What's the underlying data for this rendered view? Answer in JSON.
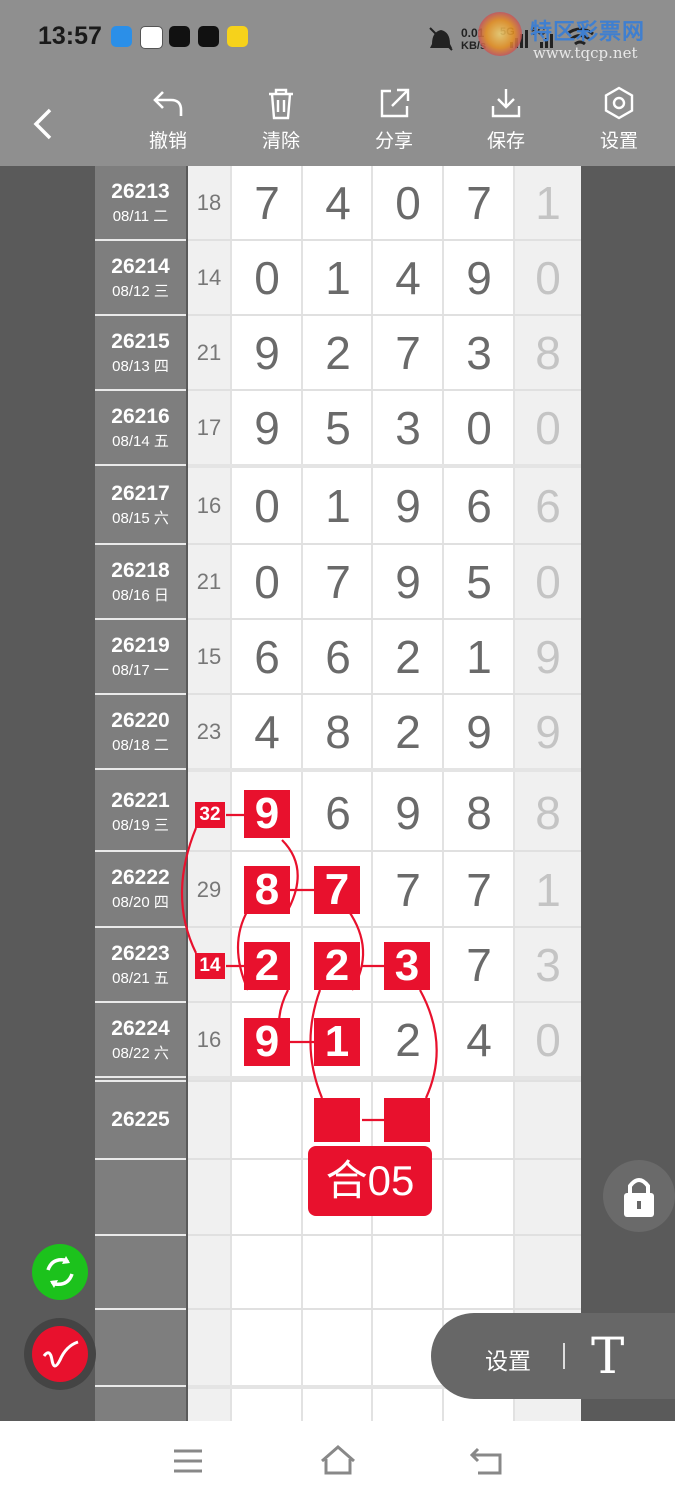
{
  "status": {
    "time": "13:57",
    "net_speed_top": "0.01",
    "net_speed_unit": "KB/s",
    "signal1": "5G",
    "signal2": "5G"
  },
  "watermark": {
    "site_name": "特区彩票网",
    "url": "www.tqcp.net"
  },
  "toolbar": {
    "undo": "撤销",
    "clear": "清除",
    "share": "分享",
    "save": "保存",
    "settings": "设置"
  },
  "rows": [
    {
      "period": "26213",
      "date": "08/11 二",
      "sum": "18",
      "digits": [
        "7",
        "4",
        "0",
        "7"
      ],
      "extra": "1"
    },
    {
      "period": "26214",
      "date": "08/12 三",
      "sum": "14",
      "digits": [
        "0",
        "1",
        "4",
        "9"
      ],
      "extra": "0"
    },
    {
      "period": "26215",
      "date": "08/13 四",
      "sum": "21",
      "digits": [
        "9",
        "2",
        "7",
        "3"
      ],
      "extra": "8"
    },
    {
      "period": "26216",
      "date": "08/14 五",
      "sum": "17",
      "digits": [
        "9",
        "5",
        "3",
        "0"
      ],
      "extra": "0"
    },
    {
      "period": "26217",
      "date": "08/15 六",
      "sum": "16",
      "digits": [
        "0",
        "1",
        "9",
        "6"
      ],
      "extra": "6"
    },
    {
      "period": "26218",
      "date": "08/16 日",
      "sum": "21",
      "digits": [
        "0",
        "7",
        "9",
        "5"
      ],
      "extra": "0"
    },
    {
      "period": "26219",
      "date": "08/17 一",
      "sum": "15",
      "digits": [
        "6",
        "6",
        "2",
        "1"
      ],
      "extra": "9"
    },
    {
      "period": "26220",
      "date": "08/18 二",
      "sum": "23",
      "digits": [
        "4",
        "8",
        "2",
        "9"
      ],
      "extra": "9"
    },
    {
      "period": "26221",
      "date": "08/19 三",
      "sum": "32",
      "digits": [
        "9",
        "6",
        "9",
        "8"
      ],
      "extra": "8"
    },
    {
      "period": "26222",
      "date": "08/20 四",
      "sum": "29",
      "digits": [
        "8",
        "7",
        "7",
        "7"
      ],
      "extra": "1"
    },
    {
      "period": "26223",
      "date": "08/21 五",
      "sum": "14",
      "digits": [
        "2",
        "2",
        "3",
        "7"
      ],
      "extra": "3"
    },
    {
      "period": "26224",
      "date": "08/22 六",
      "sum": "16",
      "digits": [
        "9",
        "1",
        "2",
        "4"
      ],
      "extra": "0"
    }
  ],
  "next_period": "26225",
  "prediction_label": "合05",
  "bottom_panel": {
    "settings_label": "设置",
    "text_tool": "T"
  },
  "colors": {
    "accent_red": "#e8112d",
    "toolbar_gray": "#8f8f8f",
    "green": "#1cc21c"
  }
}
